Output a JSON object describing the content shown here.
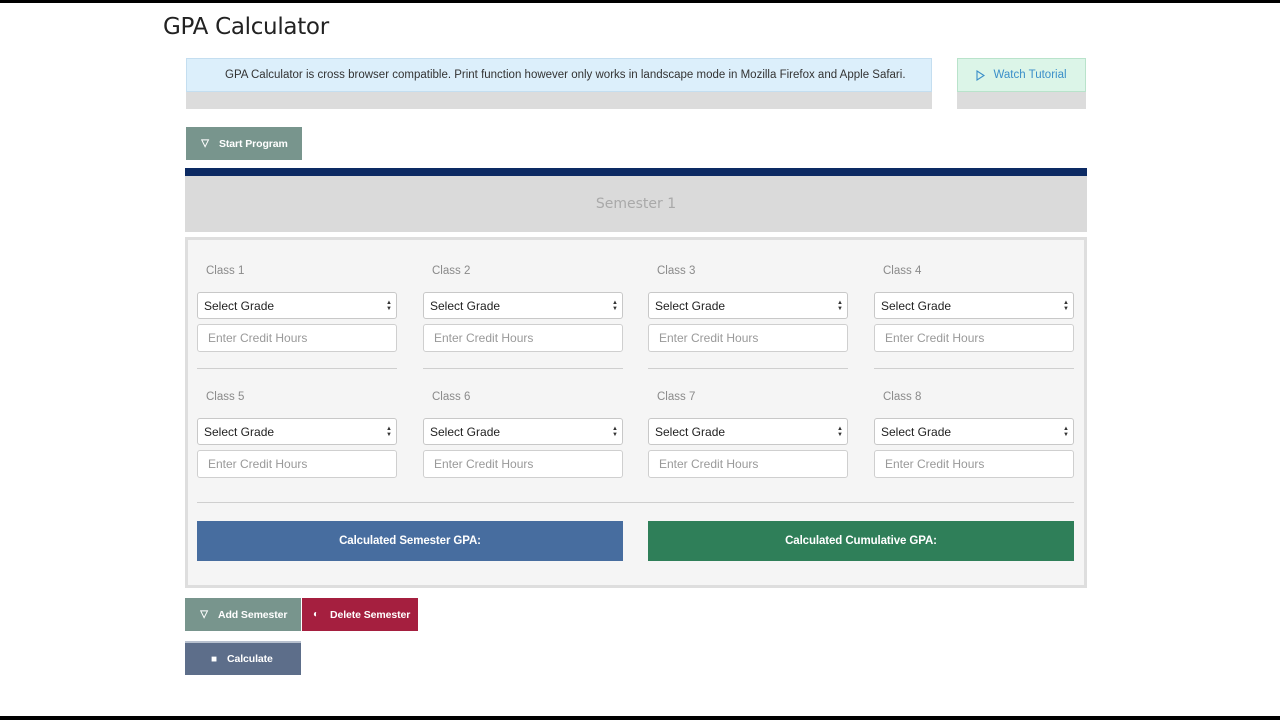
{
  "page": {
    "title": "GPA Calculator"
  },
  "notice": {
    "text": "GPA Calculator is cross browser compatible. Print function however only works in landscape mode in Mozilla Firefox and Apple Safari."
  },
  "tutorial": {
    "label": "Watch Tutorial",
    "icon": "play-outline-icon"
  },
  "buttons": {
    "start_program": "Start Program",
    "add_semester": "Add Semester",
    "delete_semester": "Delete Semester",
    "calculate": "Calculate"
  },
  "semester": {
    "title": "Semester 1",
    "classes": [
      {
        "label": "Class 1",
        "grade": "Select Grade",
        "credit_placeholder": "Enter Credit Hours"
      },
      {
        "label": "Class 2",
        "grade": "Select Grade",
        "credit_placeholder": "Enter Credit Hours"
      },
      {
        "label": "Class 3",
        "grade": "Select Grade",
        "credit_placeholder": "Enter Credit Hours"
      },
      {
        "label": "Class 4",
        "grade": "Select Grade",
        "credit_placeholder": "Enter Credit Hours"
      },
      {
        "label": "Class 5",
        "grade": "Select Grade",
        "credit_placeholder": "Enter Credit Hours"
      },
      {
        "label": "Class 6",
        "grade": "Select Grade",
        "credit_placeholder": "Enter Credit Hours"
      },
      {
        "label": "Class 7",
        "grade": "Select Grade",
        "credit_placeholder": "Enter Credit Hours"
      },
      {
        "label": "Class 8",
        "grade": "Select Grade",
        "credit_placeholder": "Enter Credit Hours"
      }
    ],
    "semester_gpa_label": "Calculated Semester GPA:",
    "cumulative_gpa_label": "Calculated Cumulative GPA:"
  },
  "colors": {
    "header_bar": "#0c2a63",
    "start_button": "#78958d",
    "delete_button": "#a51f3f",
    "calculate_button": "#5d6e8a",
    "semester_gpa": "#476d9f",
    "cumulative_gpa": "#2f7f59"
  }
}
